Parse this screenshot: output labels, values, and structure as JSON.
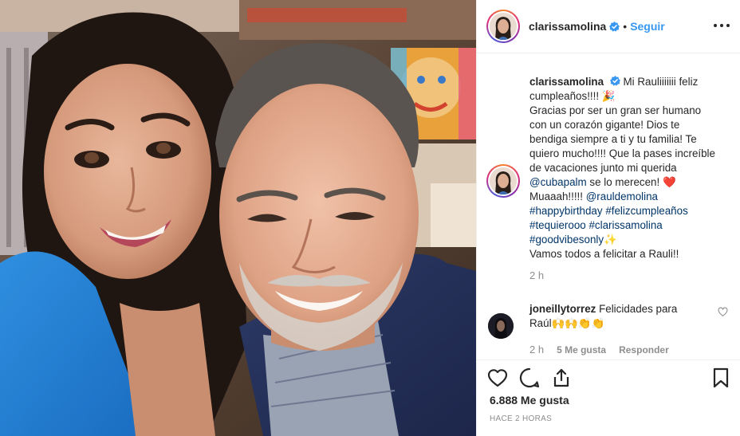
{
  "post": {
    "author": {
      "username": "clarissamolina",
      "verified": true,
      "follow_label": "Seguir",
      "more_icon": "more-horizontal-icon"
    },
    "caption": {
      "username": "clarissamolina",
      "lines": [
        "Mi Rauliiiiiii feliz cumpleaños!!!! 🎉",
        "Gracias por ser un gran ser humano con un corazón gigante! Dios te bendiga siempre a ti y tu familia! Te quiero mucho!!!! Que la pases increíble de vacaciones junto mi querida"
      ],
      "mention_cubapalm": "@cubapalm",
      "after_mention": " se lo merecen!",
      "heart_emoji": "❤️",
      "muaaah": " Muaaah!!!!! ",
      "mention_raul": "@rauldemolina",
      "hashtag_1": "#happybirthday",
      "hashtag_2": "#felizcumpleaños",
      "hashtag_3": "#tequierooo",
      "hashtag_4": "#clarissamolina",
      "hashtag_5": "#goodvibesonly",
      "sparkles": "✨",
      "closing": "Vamos todos a felicitar a Rauli!!",
      "time": "2 h"
    },
    "comment": {
      "username": "joneillytorrez",
      "text": "Felicidades para Raúl🙌🙌👏👏",
      "time": "2 h",
      "likes": "5 Me gusta",
      "reply_label": "Responder"
    },
    "actions": {
      "like_icon": "heart-icon",
      "comment_icon": "comment-icon",
      "share_icon": "share-icon",
      "save_icon": "bookmark-icon"
    },
    "likes_count": "6.888 Me gusta",
    "timestamp": "HACE 2 HORAS",
    "colors": {
      "link": "#003569",
      "follow": "#3897f0",
      "verified": "#3897f0",
      "muted": "#8e8e8e"
    }
  }
}
